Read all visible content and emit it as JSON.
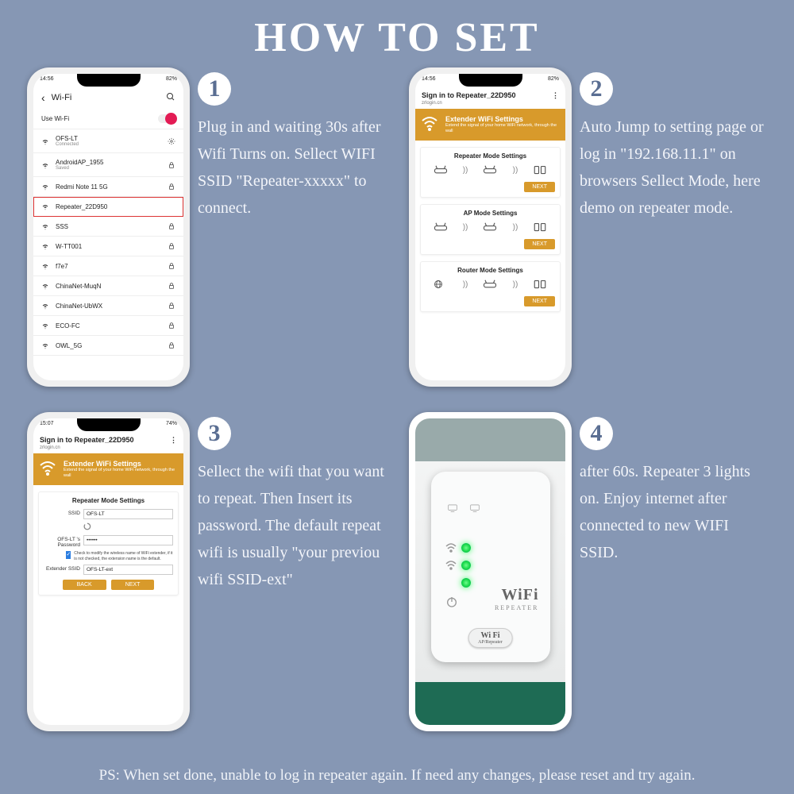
{
  "title": "HOW TO SET",
  "ps": "PS: When set done, unable to log in repeater again. If need any changes, please reset and try again.",
  "steps": {
    "s1": {
      "num": "1",
      "desc": "Plug in and waiting 30s after Wifi Turns on. Sellect WIFI SSID \"Repeater-xxxxx\" to connect."
    },
    "s2": {
      "num": "2",
      "desc": "Auto Jump to setting page or log in \"192.168.11.1\" on browsers Sellect Mode, here demo on repeater mode."
    },
    "s3": {
      "num": "3",
      "desc": "Sellect the wifi that you want to repeat. Then Insert its password. The default repeat wifi is usually \"your previou wifi SSID-ext\""
    },
    "s4": {
      "num": "4",
      "desc": "after 60s. Repeater 3 lights on. Enjoy internet after connected to new WIFI SSID."
    }
  },
  "phone1": {
    "time": "14:56",
    "batt": "82%",
    "back": "‹",
    "title": "Wi-Fi",
    "use_label": "Use Wi-Fi",
    "nets": [
      {
        "name": "OFS-LT",
        "sub": "Connected",
        "right": "gear"
      },
      {
        "name": "AndroidAP_1955",
        "sub": "Saved",
        "right": "lock"
      },
      {
        "name": "Redmi Note 11 5G",
        "sub": "",
        "right": "lock"
      },
      {
        "name": "Repeater_22D950",
        "sub": "",
        "right": "",
        "hl": true
      },
      {
        "name": "SSS",
        "sub": "",
        "right": "lock"
      },
      {
        "name": "W-TT001",
        "sub": "",
        "right": "lock"
      },
      {
        "name": "f7e7",
        "sub": "",
        "right": "lock"
      },
      {
        "name": "ChinaNet-MuqN",
        "sub": "",
        "right": "lock"
      },
      {
        "name": "ChinaNet-UbWX",
        "sub": "",
        "right": "lock"
      },
      {
        "name": "ECO-FC",
        "sub": "",
        "right": "lock"
      },
      {
        "name": "OWL_5G",
        "sub": "",
        "right": "lock"
      }
    ]
  },
  "phone2": {
    "time": "14:56",
    "batt": "82%",
    "title": "Sign in to Repeater_22D950",
    "sub": "zrlogin.cn",
    "menu": "⋮",
    "banner_title": "Extender WiFi Settings",
    "banner_sub": "Extend the signal of your home WiFi network, through the wall",
    "cards": [
      {
        "title": "Repeater Mode Settings",
        "btn": "NEXT"
      },
      {
        "title": "AP Mode Settings",
        "btn": "NEXT"
      },
      {
        "title": "Router Mode Settings",
        "btn": "NEXT"
      }
    ]
  },
  "phone3": {
    "time": "15:07",
    "batt": "74%",
    "title": "Sign in to Repeater_22D950",
    "sub": "zrlogin.cn",
    "menu": "⋮",
    "banner_title": "Extender WiFi Settings",
    "banner_sub": "Extend the signal of your home WiFi network, through the wall",
    "card_title": "Repeater Mode Settings",
    "ssid_label": "SSID",
    "ssid_value": "OFS-LT",
    "pwd_label": "OFS-LT 's Password",
    "pwd_value": "••••••",
    "note": "Check to modify the wireless name of WiFi extender, if it is not checked, the extension name is the default.",
    "ext_label": "Extender SSID",
    "ext_value": "OFS-LT-ext",
    "back": "BACK",
    "next": "NEXT"
  },
  "device": {
    "brand1": "WiFi",
    "brand2": "REPEATER",
    "pill1": "Wi      Fi",
    "pill2": "AP/Repeater"
  }
}
